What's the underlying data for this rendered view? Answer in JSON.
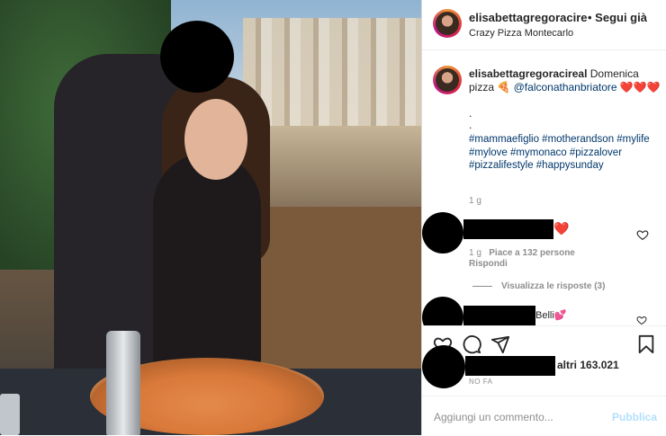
{
  "header": {
    "username": "elisabettagregoracire",
    "follow_label": "• Segui già",
    "location": "Crazy Pizza Montecarlo"
  },
  "caption": {
    "username": "elisabettagregoracireal",
    "text": " Domenica pizza 🍕 ",
    "mention": "@falconathanbriatore",
    "emoji": " ❤️❤️❤️",
    "dots": ".\n.",
    "hashtags": "#mammaefiglio #motherandson #mylife #mylove #mymonaco #pizzalover #pizzalifestyle #happysunday",
    "time": "1 g"
  },
  "comments": [
    {
      "text_suffix": "❤️",
      "time": "1 g",
      "likes": "Piace a 132 persone",
      "reply_label": "Rispondi"
    },
    {
      "text_suffix": "Belli💕"
    }
  ],
  "view_replies": "Visualizza le risposte (3)",
  "likes_text": "altri 163.021",
  "time_ago": "NO FA",
  "add_comment": {
    "placeholder": "Aggiungi un commento...",
    "publish_label": "Pubblica"
  },
  "colors": {
    "link": "#00376b",
    "muted": "#8e8e8e",
    "publish_disabled": "#b2dffc",
    "heart": "#ed4956"
  },
  "icons": [
    "heart-icon",
    "comment-icon",
    "share-icon",
    "bookmark-icon"
  ]
}
